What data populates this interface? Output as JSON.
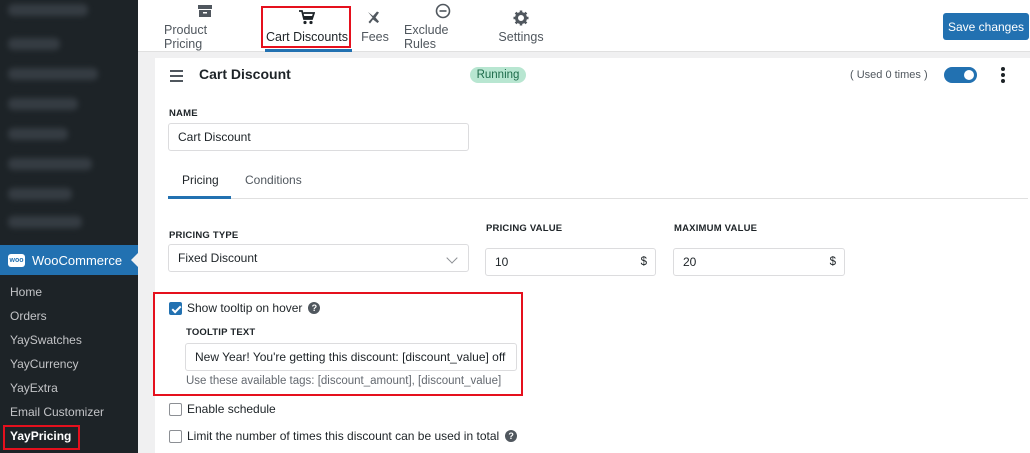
{
  "sidebar": {
    "woocommerce_label": "WooCommerce",
    "woo_logo_text": "woo",
    "submenu": [
      "Home",
      "Orders",
      "YaySwatches",
      "YayCurrency",
      "YayExtra",
      "Email Customizer",
      "YayPricing"
    ],
    "active_item": "YayPricing"
  },
  "topnav": {
    "tabs": [
      {
        "label": "Product Pricing",
        "icon": "archive-icon"
      },
      {
        "label": "Cart Discounts",
        "icon": "cart-icon"
      },
      {
        "label": "Fees",
        "icon": "plane-icon"
      },
      {
        "label": "Exclude Rules",
        "icon": "minus-circle-icon"
      },
      {
        "label": "Settings",
        "icon": "gear-icon"
      }
    ],
    "active_tab": "Cart Discounts",
    "save_label": "Save changes"
  },
  "rule": {
    "title": "Cart Discount",
    "status": "Running",
    "used": "( Used 0 times )",
    "enabled": true
  },
  "form": {
    "name_label": "NAME",
    "name_value": "Cart Discount",
    "tabs": [
      "Pricing",
      "Conditions"
    ],
    "active_tab": "Pricing",
    "pricing_type_label": "PRICING TYPE",
    "pricing_type_value": "Fixed Discount",
    "pricing_value_label": "PRICING VALUE",
    "pricing_value": "10",
    "pricing_value_suffix": "$",
    "max_value_label": "MAXIMUM VALUE",
    "max_value": "20",
    "max_value_suffix": "$",
    "show_tooltip_label": "Show tooltip on hover",
    "show_tooltip_checked": true,
    "tooltip_text_label": "TOOLTIP TEXT",
    "tooltip_text_value": "New Year! You're getting this discount: [discount_value] off",
    "tooltip_hint": "Use these available tags: [discount_amount], [discount_value]",
    "enable_schedule_label": "Enable schedule",
    "limit_label": "Limit the number of times this discount can be used in total",
    "help_glyph": "?"
  },
  "colors": {
    "accent": "#2271b1",
    "highlight": "#e5101d",
    "sidebar_bg": "#1d2327",
    "running_bg": "#b8e6d1"
  }
}
